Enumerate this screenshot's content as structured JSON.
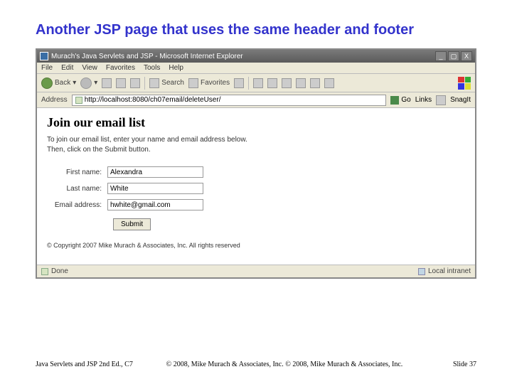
{
  "slide": {
    "title": "Another JSP page that uses the same header and footer"
  },
  "browser": {
    "window_title": "Murach's Java Servlets and JSP - Microsoft Internet Explorer",
    "menu": {
      "file": "File",
      "edit": "Edit",
      "view": "View",
      "favorites": "Favorites",
      "tools": "Tools",
      "help": "Help"
    },
    "toolbar": {
      "back": "Back",
      "search": "Search",
      "favorites": "Favorites"
    },
    "address": {
      "label": "Address",
      "url": "http://localhost:8080/ch07email/deleteUser/",
      "go": "Go",
      "links": "Links",
      "snagit": "SnagIt"
    },
    "status": {
      "done": "Done",
      "zone": "Local intranet"
    }
  },
  "page": {
    "heading": "Join our email list",
    "instr1": "To join our email list, enter your name and email address below.",
    "instr2": "Then, click on the Submit button.",
    "form": {
      "first_label": "First name:",
      "first_value": "Alexandra",
      "last_label": "Last name:",
      "last_value": "White",
      "email_label": "Email address:",
      "email_value": "hwhite@gmail.com",
      "submit": "Submit"
    },
    "copyright": "© Copyright 2007 Mike Murach & Associates, Inc. All rights reserved"
  },
  "footer": {
    "left": "Java Servlets and JSP 2nd Ed., C7",
    "center": "© 2008, Mike Murach & Associates, Inc. © 2008, Mike Murach & Associates, Inc.",
    "right": "Slide 37"
  }
}
